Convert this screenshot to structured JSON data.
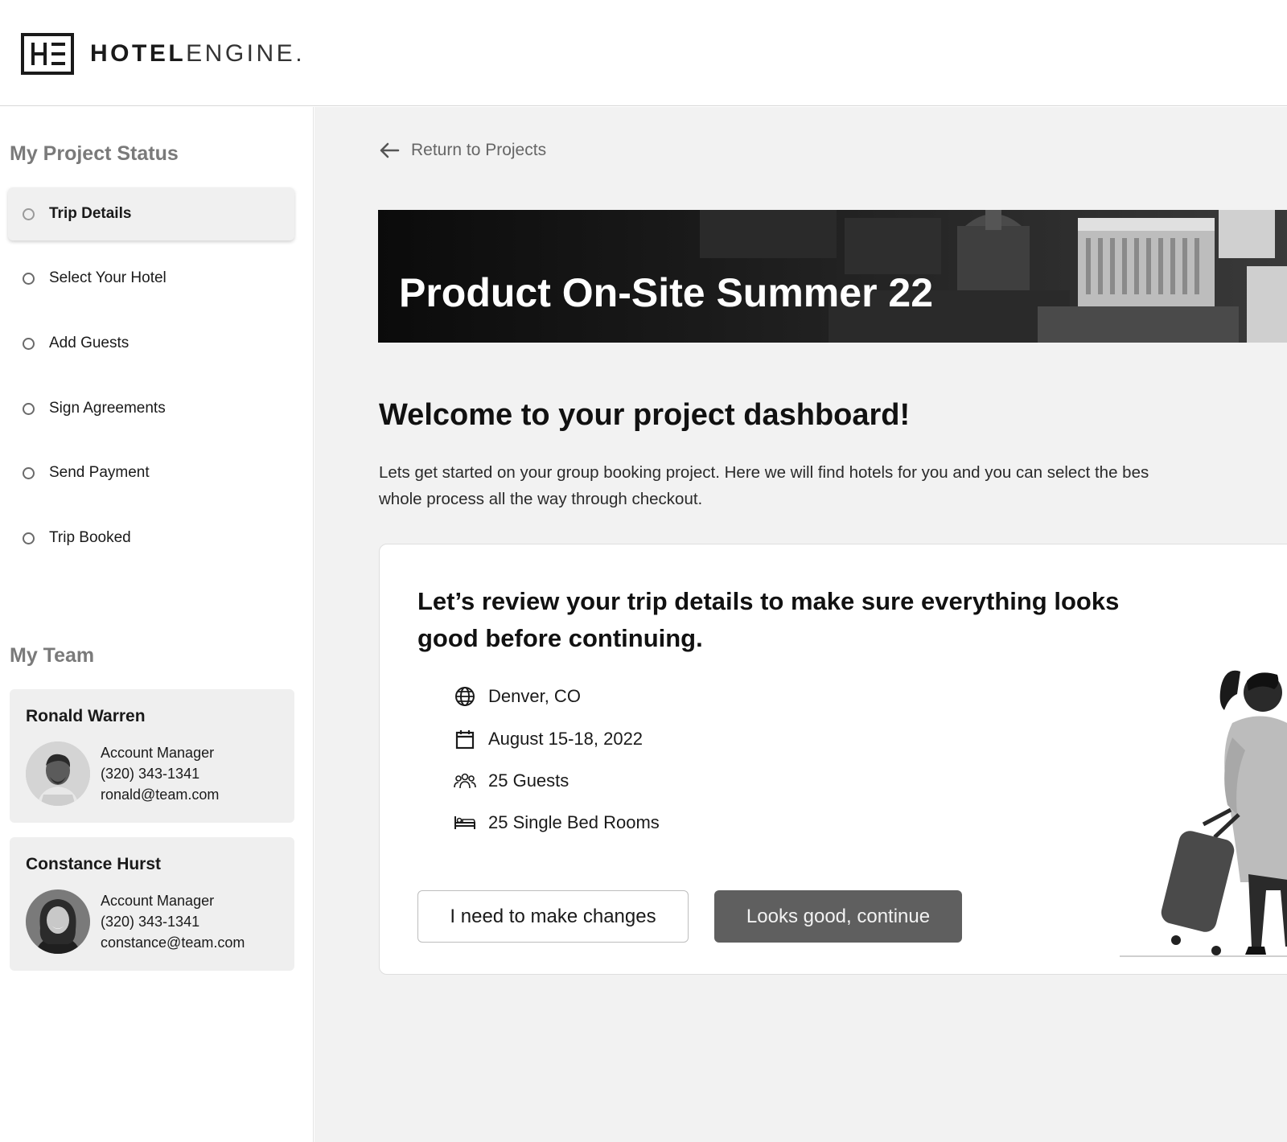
{
  "header": {
    "logo_mark": "HE",
    "logo_bold": "HOTEL",
    "logo_light": "ENGINE",
    "logo_dot": "."
  },
  "sidebar": {
    "status_title": "My Project Status",
    "steps": [
      {
        "label": "Trip Details",
        "active": true
      },
      {
        "label": "Select Your Hotel",
        "active": false
      },
      {
        "label": "Add Guests",
        "active": false
      },
      {
        "label": "Sign Agreements",
        "active": false
      },
      {
        "label": "Send Payment",
        "active": false
      },
      {
        "label": "Trip Booked",
        "active": false
      }
    ],
    "team_title": "My Team",
    "team": [
      {
        "name": "Ronald Warren",
        "role": "Account Manager",
        "phone": "(320) 343-1341",
        "email": "ronald@team.com"
      },
      {
        "name": "Constance Hurst",
        "role": "Account Manager",
        "phone": "(320) 343-1341",
        "email": "constance@team.com"
      }
    ]
  },
  "main": {
    "back_link": "Return to Projects",
    "banner_title": "Product On-Site Summer 22",
    "welcome": "Welcome to your project dashboard!",
    "intro_line1": "Lets get started on your group booking project.  Here we will find hotels for you and you can select the bes",
    "intro_line2": "whole process all the way through checkout.",
    "card": {
      "heading": "Let’s review your trip details to make sure everything looks good before continuing.",
      "details": [
        {
          "icon": "globe-icon",
          "text": "Denver, CO"
        },
        {
          "icon": "calendar-icon",
          "text": "August 15-18, 2022"
        },
        {
          "icon": "guests-icon",
          "text": "25 Guests"
        },
        {
          "icon": "bed-icon",
          "text": "25 Single Bed Rooms"
        }
      ],
      "secondary_button": "I need to make changes",
      "primary_button": "Looks good, continue"
    }
  },
  "colors": {
    "primary_button": "#5f5f5f",
    "main_bg": "#f2f2f2",
    "banner_bg": "#111111"
  }
}
